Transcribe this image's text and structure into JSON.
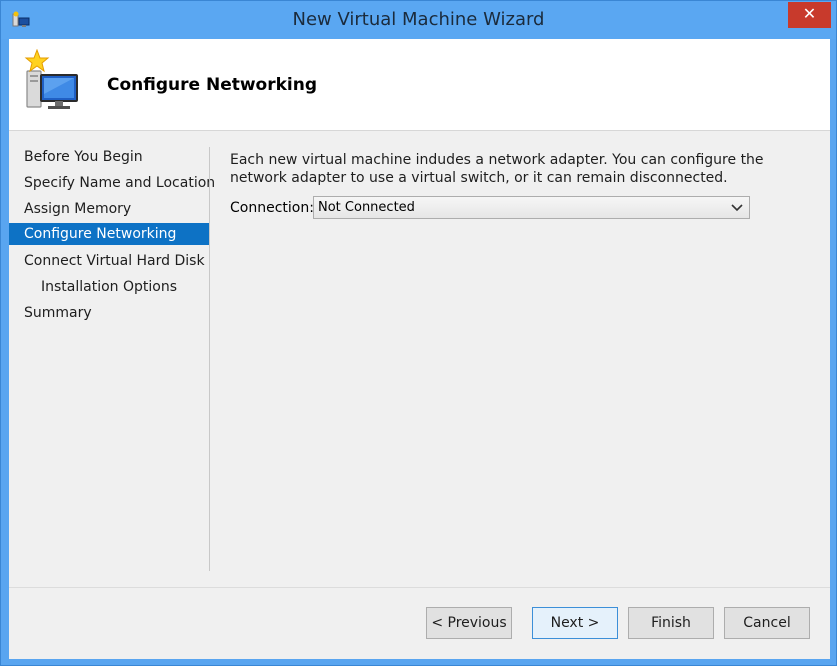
{
  "window": {
    "title": "New Virtual Machine Wizard",
    "close_label": "✕"
  },
  "header": {
    "title": "Configure Networking"
  },
  "nav": {
    "items": [
      {
        "label": "Before You Begin"
      },
      {
        "label": "Specify Name and Location"
      },
      {
        "label": "Assign Memory"
      },
      {
        "label": "Configure Networking"
      },
      {
        "label": "Connect Virtual Hard Disk"
      },
      {
        "label": "Installation Options"
      },
      {
        "label": "Summary"
      }
    ],
    "selected_index": 3
  },
  "content": {
    "description": "Each new virtual machine indudes a network adapter. You can configure the network adapter to use a virtual switch, or it can remain disconnected.",
    "connection_label": "Connection:",
    "connection_value": "Not Connected"
  },
  "buttons": {
    "previous": "< Previous",
    "next": "Next >",
    "finish": "Finish",
    "cancel": "Cancel"
  },
  "colors": {
    "titlebar": "#5aa7f2",
    "selected": "#0d72c5",
    "close": "#c83a2c"
  },
  "icons": {
    "app": "hyperv-vm-icon",
    "header": "new-vm-wizard-icon",
    "dropdown": "chevron-down-icon"
  }
}
